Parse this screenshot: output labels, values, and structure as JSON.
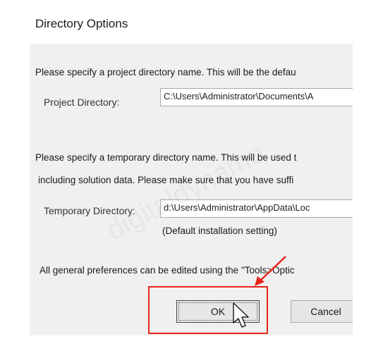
{
  "window": {
    "title": "Directory Options"
  },
  "project": {
    "description": "Please specify a project directory name. This will be the defau",
    "label": "Project Directory:",
    "value": "C:\\Users\\Administrator\\Documents\\A"
  },
  "temporary": {
    "description_line1": "Please specify a temporary directory name. This will be used t",
    "description_line2": "including solution data. Please make sure that you have suffi",
    "label": "Temporary Directory:",
    "value": "d:\\Users\\Administrator\\AppData\\Loc",
    "note": "(Default installation setting)"
  },
  "preferences_note": "All general preferences can be edited using the \"Tools>Optic",
  "buttons": {
    "ok": "OK",
    "cancel": "Cancel"
  },
  "watermark": "digitaldynamo",
  "colors": {
    "highlight": "#e8261c",
    "dialog_bg": "#f0f0f0"
  }
}
